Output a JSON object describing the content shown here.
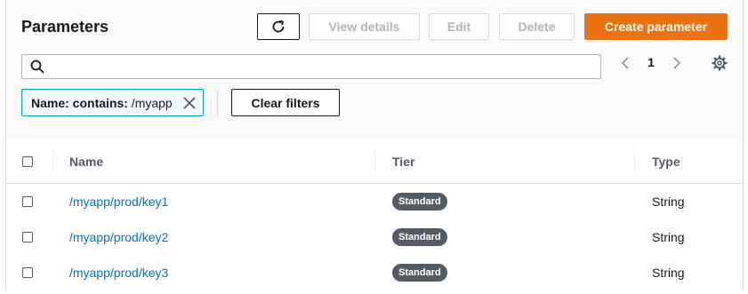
{
  "header": {
    "title": "Parameters",
    "buttons": {
      "view_details": "View details",
      "edit": "Edit",
      "delete": "Delete",
      "create": "Create parameter"
    }
  },
  "search": {
    "value": "",
    "placeholder": ""
  },
  "pagination": {
    "current_page": "1"
  },
  "filter": {
    "key": "Name: contains:",
    "value": " /myapp"
  },
  "clear_filters_label": "Clear filters",
  "table": {
    "columns": [
      "Name",
      "Tier",
      "Type"
    ],
    "rows": [
      {
        "name": "/myapp/prod/key1",
        "tier": "Standard",
        "type": "String"
      },
      {
        "name": "/myapp/prod/key2",
        "tier": "Standard",
        "type": "String"
      },
      {
        "name": "/myapp/prod/key3",
        "tier": "Standard",
        "type": "String"
      }
    ]
  },
  "colors": {
    "primary": "#ec7211",
    "link": "#0073bb",
    "filter_border": "#00a1c9",
    "badge": "#545b64"
  },
  "icons": [
    "refresh-icon",
    "search-icon",
    "chevron-left-icon",
    "chevron-right-icon",
    "gear-icon",
    "close-icon"
  ]
}
